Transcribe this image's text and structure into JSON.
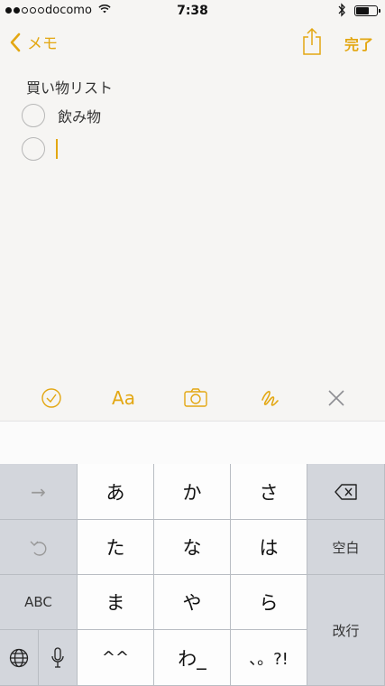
{
  "status_bar": {
    "carrier": "docomo",
    "time": "7:38",
    "wifi_icon": "wifi-icon",
    "bluetooth_icon": "bluetooth-icon",
    "battery_level": 0.8
  },
  "nav": {
    "back_label": "メモ",
    "done_label": "完了",
    "share_icon": "share-icon",
    "accent_color": "#e3a712"
  },
  "note": {
    "title": "買い物リスト",
    "items": [
      {
        "text": "飲み物",
        "checked": false
      },
      {
        "text": "",
        "checked": false
      }
    ]
  },
  "toolbar": {
    "aa_label": "Aa",
    "icons": [
      "checklist-icon",
      "text-format-icon",
      "camera-icon",
      "sketch-icon",
      "close-icon"
    ]
  },
  "keyboard": {
    "row1": {
      "left": "→",
      "keys": [
        "あ",
        "か",
        "さ"
      ],
      "right_icon": "delete-icon"
    },
    "row2": {
      "left": "↶",
      "keys": [
        "た",
        "な",
        "は"
      ],
      "right": "空白"
    },
    "row3": {
      "left": "ABC",
      "keys": [
        "ま",
        "や",
        "ら"
      ]
    },
    "row4": {
      "globe_icon": "globe-icon",
      "mic_icon": "mic-icon",
      "keys": [
        "^^",
        "わ_",
        "、。?!"
      ]
    },
    "enter": "改行"
  }
}
